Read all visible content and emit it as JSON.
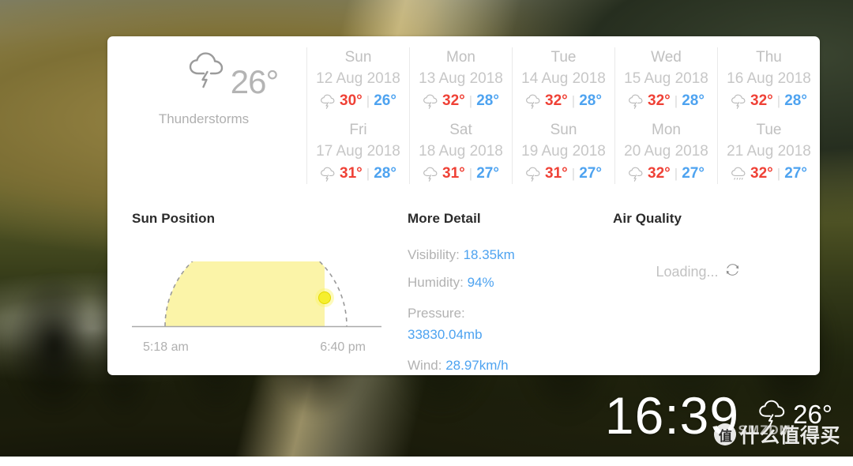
{
  "current": {
    "icon": "thunderstorm-icon",
    "temperature": "26°",
    "condition": "Thunderstorms"
  },
  "forecast_columns": [
    {
      "top": {
        "day": "Sun",
        "date": "12 Aug 2018",
        "icon": "thunderstorm-icon",
        "high": "30°",
        "low": "26°",
        "sep": "|"
      },
      "bottom": {
        "day": "Fri",
        "date": "17 Aug 2018",
        "icon": "thunderstorm-icon",
        "high": "31°",
        "low": "28°",
        "sep": "|"
      }
    },
    {
      "top": {
        "day": "Mon",
        "date": "13 Aug 2018",
        "icon": "thunderstorm-icon",
        "high": "32°",
        "low": "28°",
        "sep": "|"
      },
      "bottom": {
        "day": "Sat",
        "date": "18 Aug 2018",
        "icon": "thunderstorm-icon",
        "high": "31°",
        "low": "27°",
        "sep": "|"
      }
    },
    {
      "top": {
        "day": "Tue",
        "date": "14 Aug 2018",
        "icon": "thunderstorm-icon",
        "high": "32°",
        "low": "28°",
        "sep": "|"
      },
      "bottom": {
        "day": "Sun",
        "date": "19 Aug 2018",
        "icon": "thunderstorm-icon",
        "high": "31°",
        "low": "27°",
        "sep": "|"
      }
    },
    {
      "top": {
        "day": "Wed",
        "date": "15 Aug 2018",
        "icon": "thunderstorm-icon",
        "high": "32°",
        "low": "28°",
        "sep": "|"
      },
      "bottom": {
        "day": "Mon",
        "date": "20 Aug 2018",
        "icon": "thunderstorm-icon",
        "high": "32°",
        "low": "27°",
        "sep": "|"
      }
    },
    {
      "top": {
        "day": "Thu",
        "date": "16 Aug 2018",
        "icon": "thunderstorm-icon",
        "high": "32°",
        "low": "28°",
        "sep": "|"
      },
      "bottom": {
        "day": "Tue",
        "date": "21 Aug 2018",
        "icon": "rain-shower-icon",
        "high": "32°",
        "low": "27°",
        "sep": "|"
      }
    }
  ],
  "sun_position": {
    "title": "Sun Position",
    "sunrise": "5:18 am",
    "sunset": "6:40 pm",
    "progress_percent": 88,
    "sun_marker_icon": "sun-icon"
  },
  "more_detail": {
    "title": "More Detail",
    "rows": [
      {
        "label": "Visibility:",
        "value": "18.35km"
      },
      {
        "label": "Humidity:",
        "value": "94%"
      },
      {
        "label": "Pressure:",
        "value": "33830.04mb"
      },
      {
        "label": "Wind:",
        "value": "28.97km/h"
      }
    ]
  },
  "air_quality": {
    "title": "Air Quality",
    "status": "Loading...",
    "status_icon": "refresh-icon"
  },
  "status_bar": {
    "clock": "16:39",
    "weather_icon": "thunderstorm-icon",
    "temperature": "26°"
  },
  "watermark": {
    "logo_text": "值",
    "brand": "什么值得买",
    "brand_latin": "SMZDM"
  },
  "colors": {
    "high_temp": "#ef4136",
    "low_temp": "#4ea3f0",
    "detail_value": "#4ea3f0",
    "sun_fill": "#fbf4a8",
    "sun_marker": "#f6ef2e",
    "card_bg": "#ffffff"
  }
}
